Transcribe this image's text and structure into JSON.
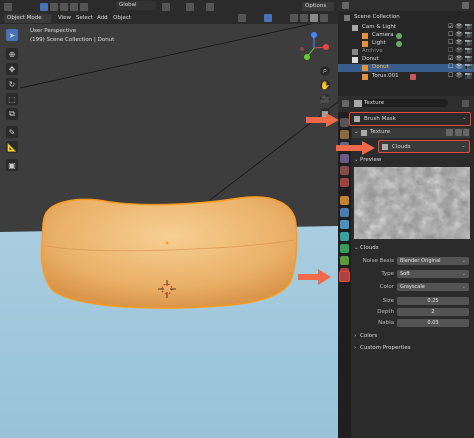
{
  "viewport": {
    "mode": "Object Mode",
    "menu": [
      "View",
      "Select",
      "Add",
      "Object"
    ],
    "transform": "Global",
    "options": "Options",
    "perspective": "User Perspective",
    "collection_info": "(199) Scene Collection | Donut"
  },
  "outliner": {
    "rows": [
      {
        "label": "Scene Collection"
      },
      {
        "label": "Cam & Light"
      },
      {
        "label": "Camera"
      },
      {
        "label": "Light"
      },
      {
        "label": "Archive"
      },
      {
        "label": "Donut"
      },
      {
        "label": "Donut"
      },
      {
        "label": "Torus.001"
      }
    ]
  },
  "properties": {
    "texture_label": "Texture",
    "brush_mask": "Brush Mask",
    "texture_block": "Texture",
    "texture_name": "Clouds",
    "preview": "Preview",
    "clouds_panel": "Clouds",
    "noise_basis_label": "Noise Basis",
    "noise_basis_value": "Blender Original",
    "type_label": "Type",
    "type_value": "Soft",
    "color_label": "Color",
    "color_value": "Grayscale",
    "size_label": "Size",
    "size_value": "0.25",
    "depth_label": "Depth",
    "depth_value": "2",
    "nabla_label": "Nabla",
    "nabla_value": "0.03",
    "colors_panel": "Colors",
    "custom_props_panel": "Custom Properties"
  },
  "colors": {
    "highlight_red": "#e84a3a",
    "selection_orange": "#ffa01c",
    "active_blue": "#3a5e8c"
  }
}
